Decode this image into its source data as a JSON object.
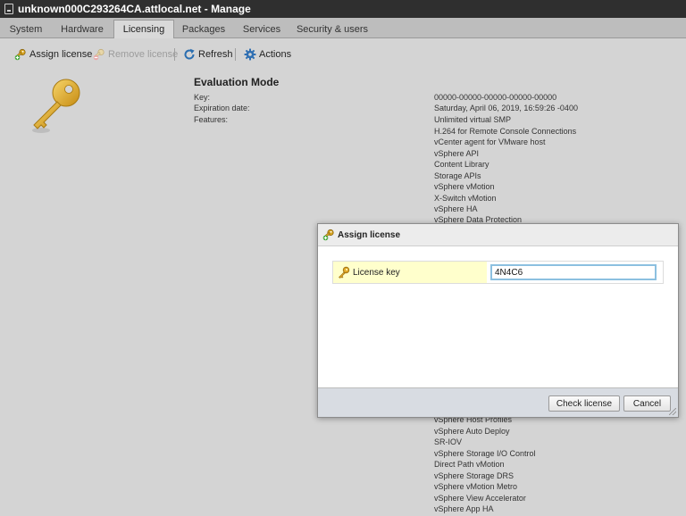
{
  "window": {
    "title": "unknown000C293264CA.attlocal.net - Manage"
  },
  "tabs": [
    {
      "label": "System"
    },
    {
      "label": "Hardware"
    },
    {
      "label": "Licensing"
    },
    {
      "label": "Packages"
    },
    {
      "label": "Services"
    },
    {
      "label": "Security & users"
    }
  ],
  "active_tab": "Licensing",
  "toolbar": {
    "assign_label": "Assign license",
    "remove_label": "Remove license",
    "refresh_label": "Refresh",
    "actions_label": "Actions"
  },
  "license": {
    "mode": "Evaluation Mode",
    "key_label": "Key:",
    "expiration_label": "Expiration date:",
    "features_label": "Features:",
    "key": "00000-00000-00000-00000-00000",
    "expiration": "Saturday, April 06, 2019, 16:59:26 -0400",
    "features": [
      "Unlimited virtual SMP",
      "H.264 for Remote Console Connections",
      "vCenter agent for VMware host",
      "vSphere API",
      "Content Library",
      "Storage APIs",
      "vSphere vMotion",
      "X-Switch vMotion",
      "vSphere HA",
      "vSphere Data Protection",
      "vSphere Host Profiles",
      "vSphere Auto Deploy",
      "SR-IOV",
      "vSphere Storage I/O Control",
      "Direct Path vMotion",
      "vSphere Storage DRS",
      "vSphere vMotion Metro",
      "vSphere View Accelerator",
      "vSphere App HA"
    ]
  },
  "dialog": {
    "title": "Assign license",
    "field_label": "License key",
    "field_value": "4N4C6",
    "check_label": "Check license",
    "cancel_label": "Cancel"
  },
  "colors": {
    "titlebar": "#2f2f2f",
    "key_gold": "#d9a520",
    "field_label_bg": "#ffffcc",
    "input_focus": "#8cc0e0"
  }
}
